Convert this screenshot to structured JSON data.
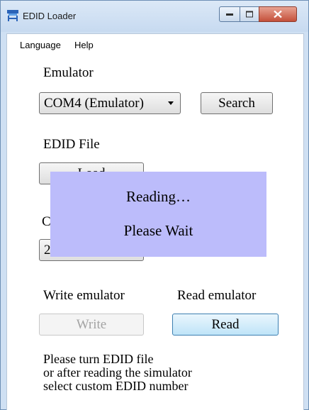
{
  "window": {
    "title": "EDID Loader",
    "icon": "edid-loader-app-icon"
  },
  "menu": {
    "items": [
      {
        "label": "Language"
      },
      {
        "label": "Help"
      }
    ]
  },
  "emulator": {
    "label": "Emulator",
    "selected_port": "COM4 (Emulator)",
    "search_label": "Search"
  },
  "edid_file": {
    "label": "EDID File",
    "load_label": "Load"
  },
  "custom": {
    "label_partial": "C",
    "value_partial": "2"
  },
  "overlay": {
    "line1": "Reading…",
    "line2": "Please Wait"
  },
  "write_section": {
    "label": "Write emulator",
    "button": "Write",
    "enabled": false
  },
  "read_section": {
    "label": "Read emulator",
    "button": "Read"
  },
  "instructions": [
    "Please turn EDID file",
    "or after reading the simulator",
    "select custom EDID number"
  ],
  "colors": {
    "overlay_bg": "#bcbcfb",
    "titlebar": "#cfe0f3",
    "close_button": "#c4503a"
  }
}
